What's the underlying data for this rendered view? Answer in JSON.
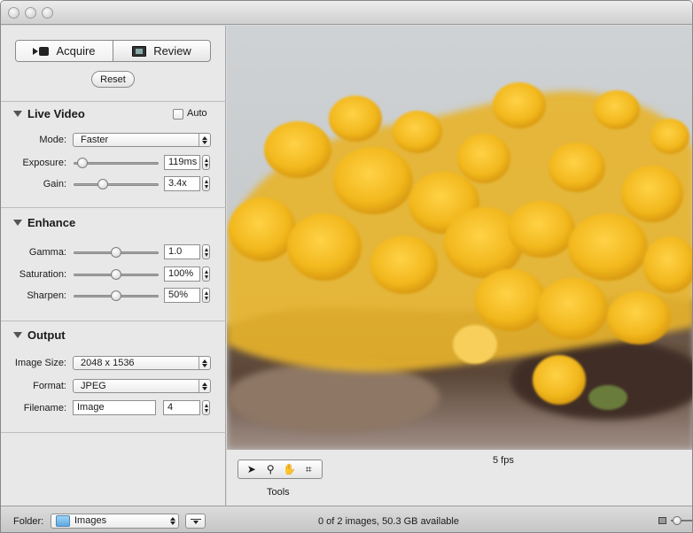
{
  "window": {
    "title": ""
  },
  "mode_segment": {
    "items": [
      {
        "label": "Acquire",
        "icon": "video-camera-icon",
        "selected": true
      },
      {
        "label": "Review",
        "icon": "film-icon",
        "selected": false
      }
    ]
  },
  "reset_label": "Reset",
  "live_video": {
    "title": "Live Video",
    "auto_label": "Auto",
    "auto_checked": false,
    "mode_label": "Mode:",
    "mode_value": "Faster",
    "exposure_label": "Exposure:",
    "exposure_value": "119ms",
    "exposure_level": 0.1,
    "gain_label": "Gain:",
    "gain_value": "3.4x",
    "gain_level": 0.34
  },
  "enhance": {
    "title": "Enhance",
    "gamma_label": "Gamma:",
    "gamma_value": "1.0",
    "gamma_level": 0.5,
    "saturation_label": "Saturation:",
    "saturation_value": "100%",
    "saturation_level": 0.5,
    "sharpen_label": "Sharpen:",
    "sharpen_value": "50%",
    "sharpen_level": 0.5
  },
  "output": {
    "title": "Output",
    "image_size_label": "Image Size:",
    "image_size_value": "2048 x 1536",
    "format_label": "Format:",
    "format_value": "JPEG",
    "filename_label": "Filename:",
    "filename_value": "Image",
    "filename_number": "4"
  },
  "viewer": {
    "fps": "5 fps",
    "tools_label": "Tools"
  },
  "statusbar": {
    "folder_label": "Folder:",
    "folder_value": "Images",
    "status": "0 of 2 images, 50.3 GB available"
  },
  "colors": {
    "lichen": "#f2b81d",
    "sky": "#c9cdd0",
    "bark": "#5a4536"
  }
}
